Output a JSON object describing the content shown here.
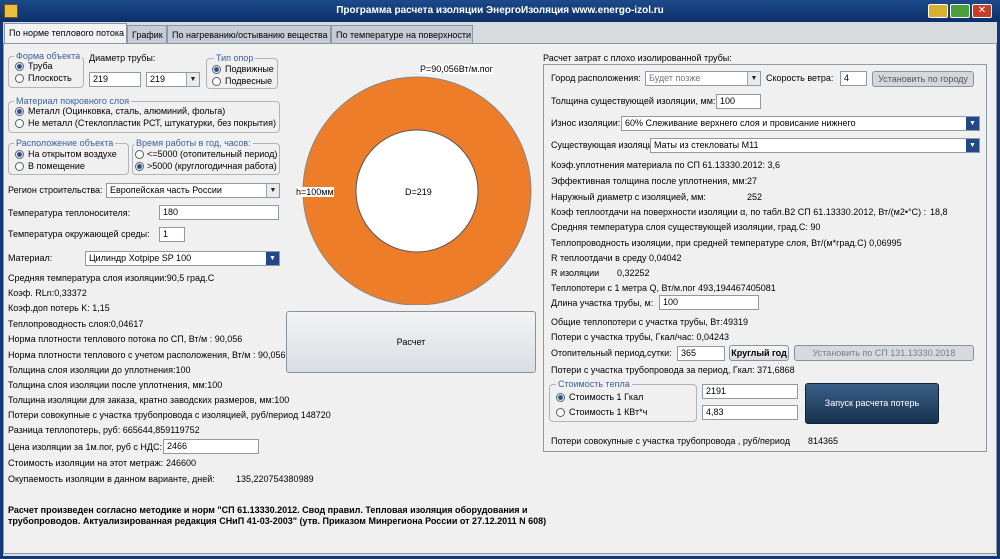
{
  "window": {
    "title": "Программа расчета изоляции ЭнергоИзоляция www.energo-izol.ru"
  },
  "tabs": [
    "По норме теплового потока",
    "График",
    "По нагреванию/остыванию вещества",
    "По температуре на поверхности"
  ],
  "object": {
    "legend": "Форма объекта",
    "opt1": "Труба",
    "opt2": "Плоскость",
    "selected": "Труба"
  },
  "diameter": {
    "label": "Диаметр трубы:",
    "value": "219",
    "select": "219"
  },
  "support": {
    "legend": "Тип опор",
    "opt1": "Подвижные",
    "opt2": "Подвесные",
    "selected": "Подвижные"
  },
  "cover": {
    "legend": "Материал покровного слоя",
    "opt1": "Металл (Оцинковка, сталь, алюминий, фольга)",
    "opt2": "Не металл (Стеклопластик РСТ, штукатурки, без покрытия)",
    "selected": "Металл (Оцинковка, сталь, алюминий, фольга)"
  },
  "location": {
    "legend": "Расположение объекта",
    "opt1": "На открытом воздухе",
    "opt2": "В помещение",
    "selected": "На открытом воздухе"
  },
  "hours": {
    "legend": "Время работы в год, часов:",
    "opt1": "<=5000 (отопительный период)",
    "opt2": ">5000 (круглогодичная работа)",
    "selected": ">5000 (круглогодичная работа)"
  },
  "region": {
    "label": "Регион строительства:",
    "value": "Европейская часть России"
  },
  "t_carrier": {
    "label": "Температура теплоносителя:",
    "value": "180"
  },
  "t_ambient": {
    "label": "Температура окружающей среды:",
    "value": "1"
  },
  "material": {
    "label": "Материал:",
    "value": "Цилиндр Xotpipe SP 100"
  },
  "results": [
    "Средняя температура слоя изоляции:90,5 град.С",
    "Коэф. RLn:0,33372",
    "Коэф.доп потерь K: 1,15",
    "Теплопроводность слоя:0,04617",
    "Норма плотности теплового потока по СП, Вт/м : 90,056",
    "Норма плотности теплового с учетом расположения, Вт/м : 90,056",
    "Толщина слоя изоляции до уплотнения:100",
    "Толщина слоя изоляции после уплотнения, мм:100",
    "Толщина изоляции для заказа, кратно заводских размеров, мм:100",
    "Потери совокупные с участка трубопровода с изоляцией, руб/период   148720",
    "Разница теплопотерь, руб:  665644,859119752"
  ],
  "price": {
    "label": "Цена изоляции за 1м.пог, руб с НДС:",
    "value": "2466"
  },
  "cost": {
    "label": "Стоимость изоляции на этот метраж:",
    "value": "246600"
  },
  "payback": {
    "label": "Окупаемость изоляции в данном варианте, дней:",
    "value": "135,220754380989"
  },
  "diagram": {
    "top_label": "P=90,056Вт/м.пог",
    "side_label": "h=100мм",
    "center_label": "D=219",
    "ring_color": "#ee7d2a",
    "core_color": "#ffffff"
  },
  "calc_button": "Расчет",
  "footer": "Расчет произведен согласно методике и норм \"СП 61.13330.2012. Свод правил. Тепловая изоляция оборудования и трубопроводов. Актуализированная редакция СНиП 41-03-2003\" (утв. Приказом Минрегиона России от 27.12.2011 N 608)",
  "right": {
    "title": "Расчет затрат с плохо изолированной трубы:",
    "city_label": "Город расположения:",
    "city_value": "Будет позже",
    "wind_label": "Скорость ветра:",
    "wind_value": "4",
    "set_city_btn": "Установить по городу",
    "thickness_label": "Толщина существующей изоляции, мм:",
    "thickness_value": "100",
    "wear_label": "Износ изоляции:",
    "wear_value": "60% Слеживание верхнего слоя и провисание нижнего",
    "existing_label": "Существующая изоляция:",
    "existing_value": "Маты из стекловаты М11",
    "r1": "Коэф.уплотнения материала по СП 61.13330.2012: 3,6",
    "r2_label": "Эффективная толщина после уплотнения, мм:",
    "r2_value": "27",
    "r3_label": "Наружный диаметр с изоляцией, мм:",
    "r3_value": "252",
    "r4_label": "Коэф теплоотдачи на поверхности изоляции α, по табл.В2 СП 61.13330.2012, Вт/(м2•°С) :",
    "r4_value": "18,8",
    "r5": "Средняя температура слоя существующей изоляции, град.С:  90",
    "r6": "Теплопроводность изоляции, при средней температуре слоя, Вт/(м*град.С)  0,06995",
    "r7": "R теплоотдачи в среду  0,04042",
    "r8_label": "R изоляции",
    "r8_value": "0,32252",
    "r9": "Теплопотери с 1 метра Q, Вт/м.пог  493,194467405081",
    "length_label": "Длина участка трубы, м:",
    "length_value": "100",
    "r10_label": "Общие теплопотери с участка трубы, Вт:",
    "r10_value": "49319",
    "r11": "Потери с участка трубы, Гкал/час:  0,04243",
    "period_label": "Отопительный период,сутки:",
    "period_value": "365",
    "yearround_btn": "Круглый год",
    "sp_btn": "Установить по СП 131.13330.2018",
    "r12": "Потери с участка трубопровода за период, Гкал:  371,6868",
    "cost_legend": "Стоимость тепла",
    "cost_opt1": "Стоимость 1 Гкал",
    "cost_opt2": "Стоимость 1 КВт*ч",
    "cost_v1": "2191",
    "cost_v2": "4,83",
    "run_btn": "Запуск расчета потерь",
    "total_label": "Потери совокупные с участка трубопровода , руб/период",
    "total_value": "814365"
  }
}
